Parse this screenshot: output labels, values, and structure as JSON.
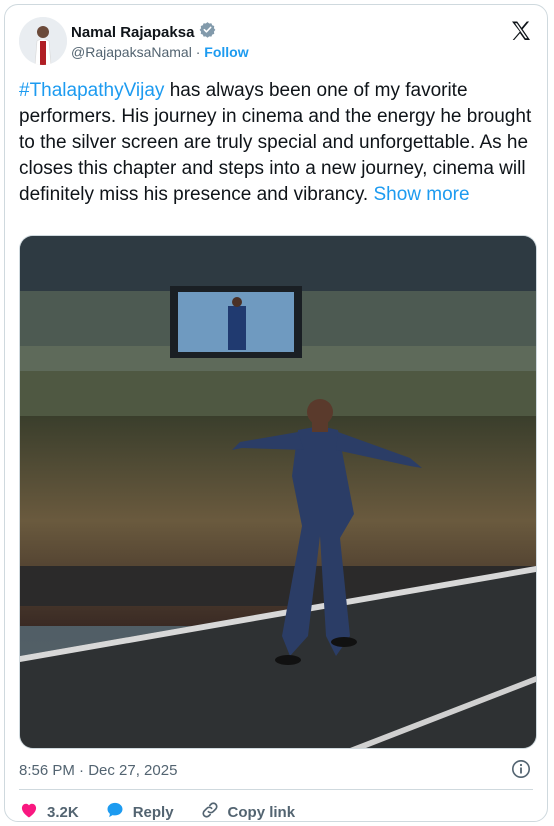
{
  "author": {
    "name": "Namal Rajapaksa",
    "handle": "@RajapaksaNamal",
    "separator": "·",
    "follow_label": "Follow"
  },
  "tweet": {
    "hashtag": "#ThalapathyVijay",
    "text": " has always been one of my favorite performers. His journey in cinema and the energy he brought to the silver screen are truly special and unforgettable. As he closes this chapter and steps into a new journey, cinema will definitely miss his presence and vibrancy.",
    "show_more": "Show more"
  },
  "timestamp": "8:56 PM · Dec 27, 2025",
  "actions": {
    "likes": "3.2K",
    "reply_label": "Reply",
    "copy_link_label": "Copy link"
  },
  "colors": {
    "accent": "#1d9bf0",
    "like": "#f91880",
    "verified": "#829aab"
  }
}
